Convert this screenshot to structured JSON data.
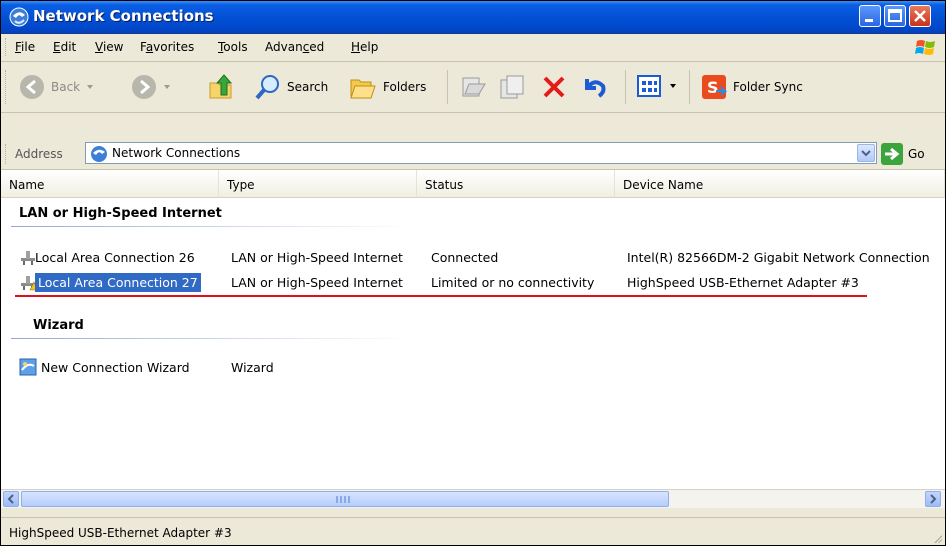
{
  "window": {
    "title": "Network Connections"
  },
  "menu": {
    "items": [
      {
        "key": "F",
        "rest": "ile"
      },
      {
        "key": "E",
        "rest": "dit"
      },
      {
        "key": "V",
        "rest": "iew"
      },
      {
        "pre": "F",
        "key": "a",
        "rest": "vorites"
      },
      {
        "key": "T",
        "rest": "ools"
      },
      {
        "pre": "Advan",
        "key": "c",
        "rest": "ed"
      },
      {
        "key": "H",
        "rest": "elp"
      }
    ]
  },
  "toolbar": {
    "back_label": "Back",
    "search_label": "Search",
    "folders_label": "Folders",
    "folder_sync_label": "Folder Sync"
  },
  "address": {
    "label": "Address",
    "value": "Network Connections",
    "go_label": "Go"
  },
  "columns": [
    "Name",
    "Type",
    "Status",
    "Device Name"
  ],
  "groups": [
    {
      "title": "LAN or High-Speed Internet",
      "rows": [
        {
          "name": "Local Area Connection 26",
          "type": "LAN or High-Speed Internet",
          "status": "Connected",
          "device": "Intel(R) 82566DM-2 Gigabit Network Connection"
        },
        {
          "name": "Local Area Connection 27",
          "type": "LAN or High-Speed Internet",
          "status": "Limited or no connectivity",
          "device": "HighSpeed USB-Ethernet Adapter #3"
        }
      ]
    },
    {
      "title": "Wizard",
      "rows": [
        {
          "name": "New Connection Wizard",
          "type": "Wizard",
          "status": "",
          "device": ""
        }
      ]
    }
  ],
  "status_bar": {
    "text": "HighSpeed USB-Ethernet Adapter #3"
  },
  "colors": {
    "title_blue": "#0351d6",
    "selection": "#316ac5",
    "annotation_red": "#e0101a"
  }
}
